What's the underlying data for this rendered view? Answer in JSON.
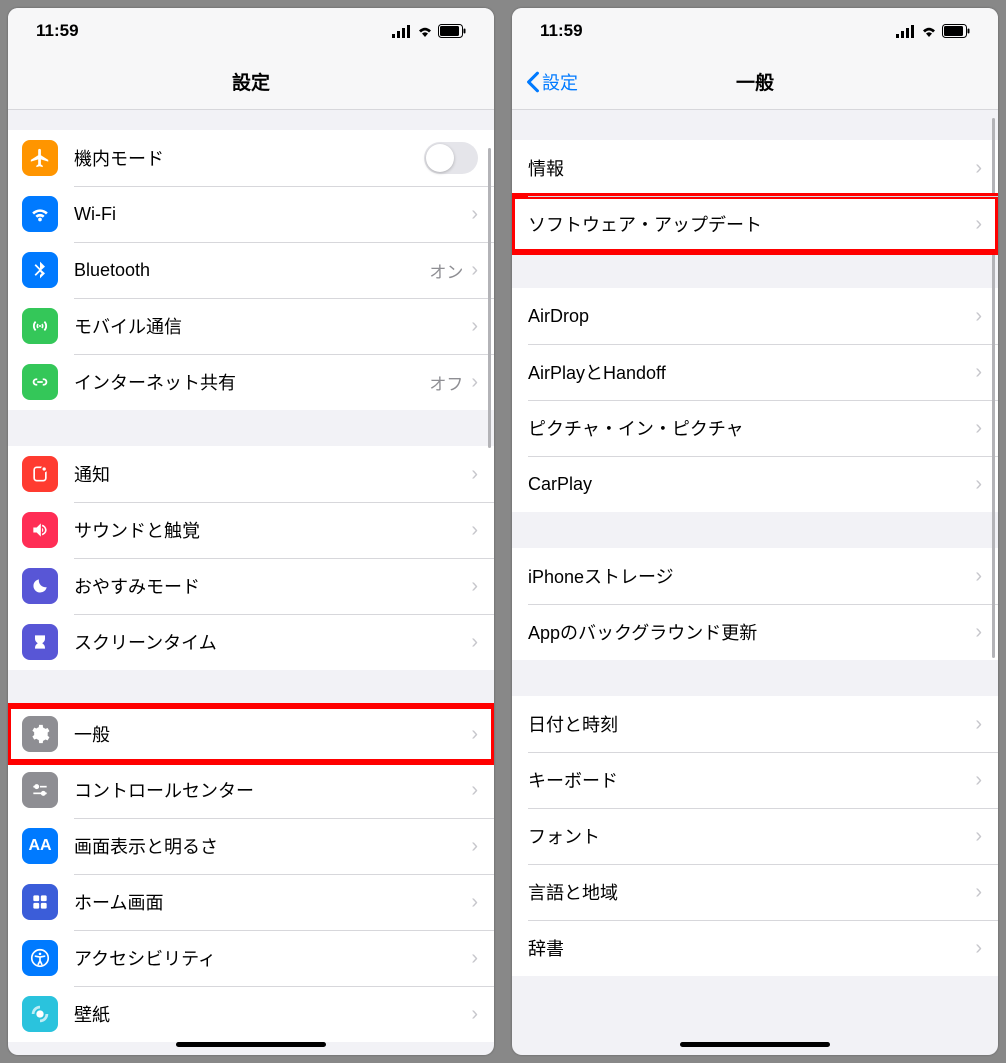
{
  "status": {
    "time": "11:59"
  },
  "left": {
    "title": "設定",
    "group1": [
      {
        "icon": "airplane-icon",
        "bg": "#ff9500",
        "label": "機内モード",
        "type": "toggle"
      },
      {
        "icon": "wifi-icon",
        "bg": "#007aff",
        "label": "Wi-Fi",
        "value": "",
        "type": "nav"
      },
      {
        "icon": "bluetooth-icon",
        "bg": "#007aff",
        "label": "Bluetooth",
        "value": "オン",
        "type": "nav"
      },
      {
        "icon": "cellular-icon",
        "bg": "#34c759",
        "label": "モバイル通信",
        "type": "nav"
      },
      {
        "icon": "hotspot-icon",
        "bg": "#34c759",
        "label": "インターネット共有",
        "value": "オフ",
        "type": "nav"
      }
    ],
    "group2": [
      {
        "icon": "notifications-icon",
        "bg": "#ff3b30",
        "label": "通知",
        "type": "nav"
      },
      {
        "icon": "sounds-icon",
        "bg": "#ff2d55",
        "label": "サウンドと触覚",
        "type": "nav"
      },
      {
        "icon": "dnd-icon",
        "bg": "#5856d6",
        "label": "おやすみモード",
        "type": "nav"
      },
      {
        "icon": "screentime-icon",
        "bg": "#5856d6",
        "label": "スクリーンタイム",
        "type": "nav"
      }
    ],
    "group3": [
      {
        "icon": "general-icon",
        "bg": "#8e8e93",
        "label": "一般",
        "type": "nav",
        "highlight": true
      },
      {
        "icon": "controlcenter-icon",
        "bg": "#8e8e93",
        "label": "コントロールセンター",
        "type": "nav"
      },
      {
        "icon": "display-icon",
        "bg": "#007aff",
        "label": "画面表示と明るさ",
        "type": "nav"
      },
      {
        "icon": "homescreen-icon",
        "bg": "#3b5dd9",
        "label": "ホーム画面",
        "type": "nav"
      },
      {
        "icon": "accessibility-icon",
        "bg": "#007aff",
        "label": "アクセシビリティ",
        "type": "nav"
      },
      {
        "icon": "wallpaper-icon",
        "bg": "#2ac3dd",
        "label": "壁紙",
        "type": "nav"
      }
    ]
  },
  "right": {
    "back": "設定",
    "title": "一般",
    "group1": [
      {
        "label": "情報",
        "type": "nav"
      },
      {
        "label": "ソフトウェア・アップデート",
        "type": "nav",
        "highlight": true
      }
    ],
    "group2": [
      {
        "label": "AirDrop",
        "type": "nav"
      },
      {
        "label": "AirPlayとHandoff",
        "type": "nav"
      },
      {
        "label": "ピクチャ・イン・ピクチャ",
        "type": "nav"
      },
      {
        "label": "CarPlay",
        "type": "nav"
      }
    ],
    "group3": [
      {
        "label": "iPhoneストレージ",
        "type": "nav"
      },
      {
        "label": "Appのバックグラウンド更新",
        "type": "nav"
      }
    ],
    "group4": [
      {
        "label": "日付と時刻",
        "type": "nav"
      },
      {
        "label": "キーボード",
        "type": "nav"
      },
      {
        "label": "フォント",
        "type": "nav"
      },
      {
        "label": "言語と地域",
        "type": "nav"
      },
      {
        "label": "辞書",
        "type": "nav"
      }
    ]
  }
}
